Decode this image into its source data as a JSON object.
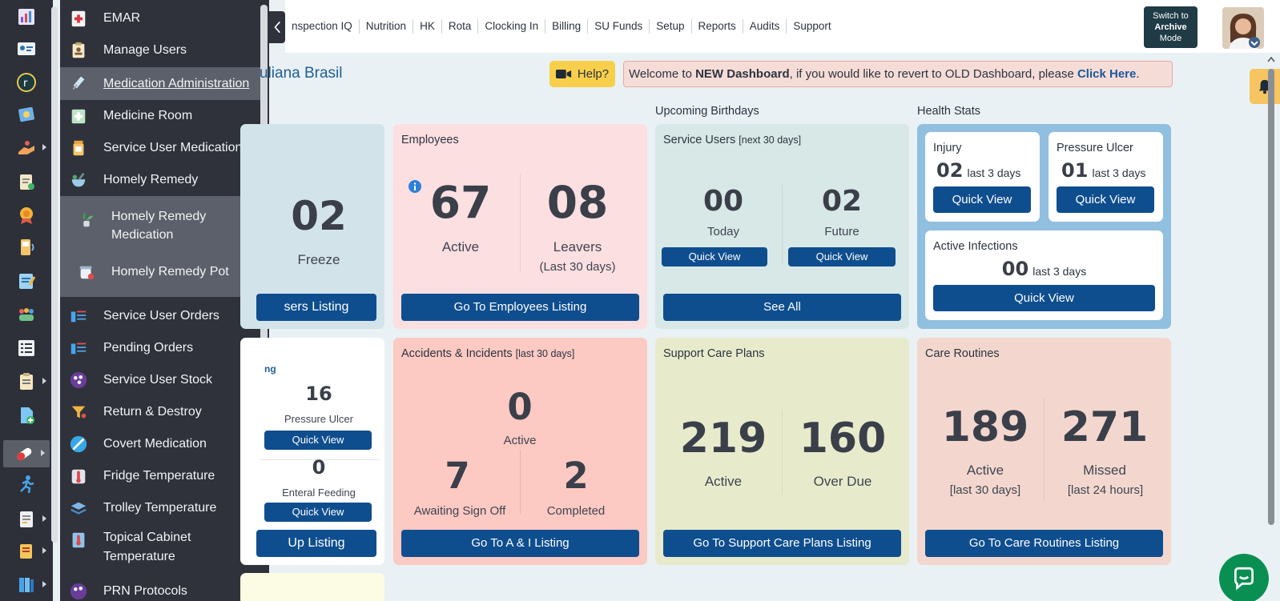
{
  "rail": {
    "icons": [
      "dashboard-icon",
      "id-card-icon",
      "r-logo-icon",
      "puzzle-icon",
      "hand-care-icon",
      "clipboard-check-icon",
      "award-badge-icon",
      "pager-icon",
      "notepad-icon",
      "people-group-icon",
      "list-icon",
      "clipboard-list-icon",
      "document-add-icon",
      "pill-icon",
      "running-figure-icon",
      "file-report-icon",
      "scroll-icon",
      "book-stack-icon"
    ]
  },
  "menu": {
    "items": [
      {
        "label": "EMAR"
      },
      {
        "label": "Manage Users"
      },
      {
        "label": "Medication Administration"
      },
      {
        "label": "Medicine Room"
      },
      {
        "label": "Service User Medication"
      },
      {
        "label": "Homely Remedy"
      },
      {
        "label": "Homely Remedy Medication"
      },
      {
        "label": "Homely Remedy Pot"
      },
      {
        "label": "Service User Orders"
      },
      {
        "label": "Pending Orders"
      },
      {
        "label": "Service User Stock"
      },
      {
        "label": "Return & Destroy"
      },
      {
        "label": "Covert Medication"
      },
      {
        "label": "Fridge Temperature"
      },
      {
        "label": "Trolley Temperature"
      },
      {
        "label": "Topical Cabinet Temperature"
      },
      {
        "label": "PRN Protocols"
      }
    ]
  },
  "topnav": [
    "nspection IQ",
    "Nutrition",
    "HK",
    "Rota",
    "Clocking In",
    "Billing",
    "SU Funds",
    "Setup",
    "Reports",
    "Audits",
    "Support"
  ],
  "archive": {
    "line1": "Switch to",
    "line2": "Archive",
    "line3": "Mode"
  },
  "page_title": "uliana Brasil",
  "help": {
    "label": "Help?"
  },
  "welcome": {
    "pre": "Welcome to ",
    "bold": "NEW Dashboard",
    "mid": ", if you would like to revert to OLD Dashboard, please ",
    "link": "Click Here",
    "post": "."
  },
  "sections": {
    "birthdays": "Upcoming Birthdays",
    "health": "Health Stats"
  },
  "su_card": {
    "value": "02",
    "label": "Freeze",
    "button": "sers Listing"
  },
  "employees": {
    "title": "Employees",
    "active": "67",
    "active_label": "Active",
    "leavers": "08",
    "leavers_label": "Leavers",
    "leavers_sub": "(Last 30 days)",
    "button": "Go To Employees Listing"
  },
  "birthdays": {
    "title": "Service Users",
    "title_sub": "[next 30 days]",
    "today": "00",
    "today_label": "Today",
    "future": "02",
    "future_label": "Future",
    "quick": "Quick View",
    "button": "See All"
  },
  "health": {
    "injury": {
      "title": "Injury",
      "value": "02",
      "sub": "last 3 days",
      "button": "Quick View"
    },
    "pressure": {
      "title": "Pressure Ulcer",
      "value": "01",
      "sub": "last 3 days",
      "button": "Quick View"
    },
    "infections": {
      "title": "Active Infections",
      "value": "00",
      "sub": "last 3 days",
      "button": "Quick View"
    }
  },
  "wound_card": {
    "link": "ng",
    "pressure_value": "16",
    "pressure_label": "Pressure Ulcer",
    "enteral_value": "0",
    "enteral_label": "Enteral Feeding",
    "quick": "Quick View",
    "button": "Up Listing"
  },
  "accidents": {
    "title": "Accidents & Incidents",
    "title_sub": "[last 30 days]",
    "active": "0",
    "active_label": "Active",
    "awaiting": "7",
    "awaiting_label": "Awaiting Sign Off",
    "completed": "2",
    "completed_label": "Completed",
    "button": "Go To A & I Listing"
  },
  "support_plans": {
    "title": "Support Care Plans",
    "active": "219",
    "active_label": "Active",
    "overdue": "160",
    "overdue_label": "Over Due",
    "button": "Go To Support Care Plans Listing"
  },
  "routines": {
    "title": "Care Routines",
    "active": "189",
    "active_label": "Active",
    "active_sub": "[last 30 days]",
    "missed": "271",
    "missed_label": "Missed",
    "missed_sub": "[last 24 hours]",
    "button": "Go To Care Routines Listing"
  },
  "colors": {
    "primary": "#0f4e8e",
    "sidebar": "#2f323b",
    "employees_bg": "#fbdfe1",
    "birthdays_bg": "#d7e8e6",
    "health_bg": "#90bfdf",
    "accidents_bg": "#fcc9c3",
    "support_bg": "#e7ebcb",
    "routines_bg": "#f3d7ce"
  }
}
